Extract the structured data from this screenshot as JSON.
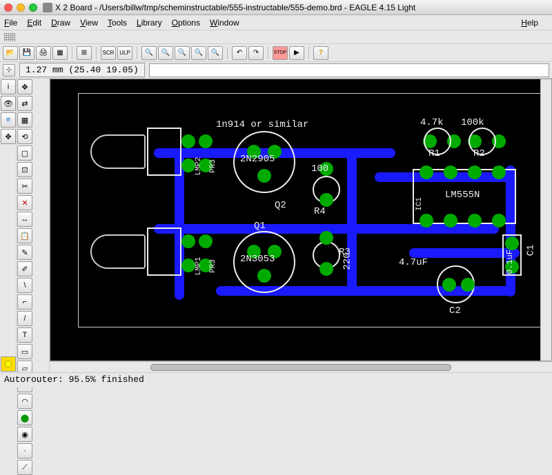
{
  "window": {
    "title": "2 Board - /Users/billw/tmp/scheminstructable/555-instructable/555-demo.brd - EAGLE 4.15 Light",
    "title_prefix": "X"
  },
  "menu": {
    "file": "File",
    "edit": "Edit",
    "draw": "Draw",
    "view": "View",
    "tools": "Tools",
    "library": "Library",
    "options": "Options",
    "window": "Window",
    "help": "Help"
  },
  "coords": {
    "label": "1.27 mm (25.40 19.05)",
    "input_value": ""
  },
  "toolbar_icons": {
    "open": "📂",
    "save": "💾",
    "print": "🖨",
    "script": "SCR",
    "ulp": "ULP",
    "zoomin": "🔍+",
    "zoomout": "🔍-",
    "zoomfit": "🔍□",
    "zoomsel": "🔍▣",
    "redraw": "🔍↻",
    "undo": "↶",
    "redo": "↷",
    "stop": "STOP",
    "cancel": "✕",
    "help": "?"
  },
  "left_tools": {
    "info": "i",
    "eye": "👁",
    "layers": "≡",
    "grid": "⊞",
    "warn": "!"
  },
  "tool_palette": [
    "↖",
    "✥",
    "✴",
    "▦",
    "▢",
    "⊡",
    "✂",
    "↔",
    "✎",
    "\\",
    "/",
    "▭",
    "○",
    "⬤"
  ],
  "tool_palette_col2": [
    "✥",
    "≡",
    "⊞",
    "⊟",
    "□",
    "↕",
    "✕",
    "⟲",
    "T",
    "T",
    "▢",
    "▢",
    "●",
    "·"
  ],
  "board": {
    "labels": {
      "diode_note": "1n914 or similar",
      "q2_part": "2N2905",
      "q1_part": "2N3053",
      "r4_val": "100",
      "r3_val": "220",
      "r1_val": "4.7k",
      "r2_val": "100k",
      "c2_val": "4.7uF",
      "c1_val": "0.1uF",
      "ic1_part": "LM555N",
      "q1_ref": "Q1",
      "q2_ref": "Q2",
      "r1_ref": "R1",
      "r2_ref": "R2",
      "r3_ref": "R3",
      "r4_ref": "R4",
      "c1_ref": "C1",
      "c2_ref": "C2",
      "ic1_ref": "IC1",
      "lmp1": "LMP1",
      "lmp2": "LMP2",
      "pr3a": "PR3",
      "pr3b": "PR3"
    }
  },
  "status": {
    "text": "Autorouter: 95.5% finished"
  }
}
